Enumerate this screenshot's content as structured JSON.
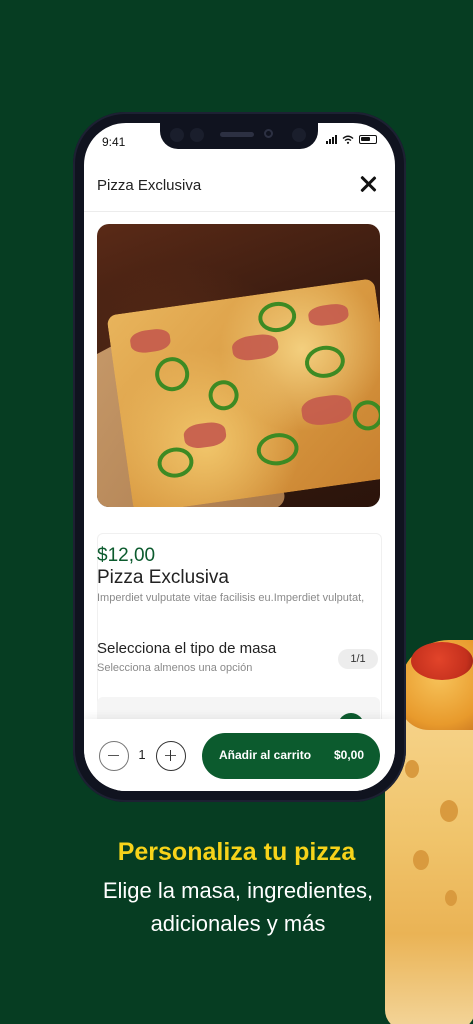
{
  "status": {
    "time": "9:41"
  },
  "header": {
    "title": "Pizza Exclusiva"
  },
  "product": {
    "price": "$12,00",
    "name": "Pizza Exclusiva",
    "description": "Imperdiet vulputate vitae facilisis eu.Imperdiet vulputat,"
  },
  "dough_section": {
    "title": "Selecciona el tipo de masa",
    "subtitle": "Selecciona almenos una opción",
    "counter": "1/1"
  },
  "cart_bar": {
    "quantity": "1",
    "add_label": "Añadir al carrito",
    "add_price": "$0,00"
  },
  "promo": {
    "title": "Personaliza tu pizza",
    "subtitle": "Elige la masa, ingredientes, adicionales y más"
  },
  "colors": {
    "background": "#063d22",
    "primary": "#0c5b2e",
    "promo_title": "#f7d31a"
  },
  "icons": [
    "signal-icon",
    "wifi-icon",
    "battery-icon",
    "close-icon",
    "minus-icon",
    "plus-icon"
  ]
}
